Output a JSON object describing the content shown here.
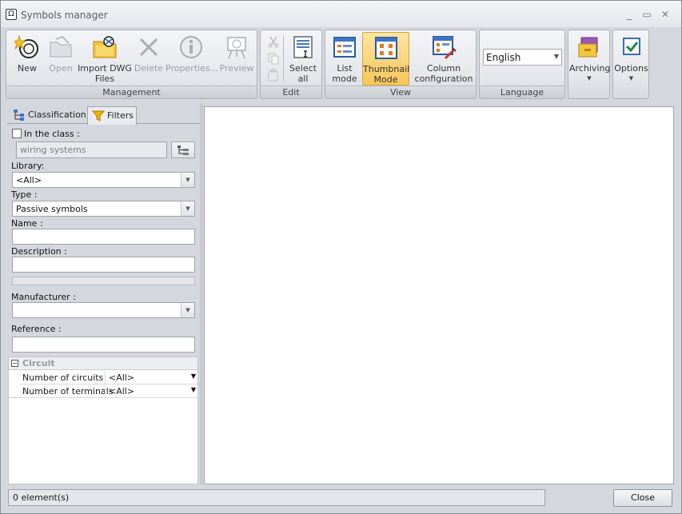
{
  "window": {
    "title": "Symbols manager",
    "minimize": "_",
    "maximize": "▭",
    "close": "✕"
  },
  "ribbon": {
    "management": {
      "label": "Management",
      "new": "New",
      "open": "Open",
      "import_line1": "Import DWG",
      "import_line2": "Files",
      "delete": "Delete",
      "properties": "Properties...",
      "preview": "Preview"
    },
    "edit": {
      "label": "Edit",
      "select_line1": "Select",
      "select_line2": "all"
    },
    "view": {
      "label": "View",
      "list_line1": "List",
      "list_line2": "mode",
      "thumb_line1": "Thumbnail",
      "thumb_line2": "Mode",
      "col_line1": "Column",
      "col_line2": "configuration"
    },
    "language": {
      "label": "Language",
      "value": "English"
    },
    "archiving": {
      "label": "Archiving"
    },
    "options": {
      "label": "Options"
    }
  },
  "tabs": {
    "classification": "Classification",
    "filters": "Filters"
  },
  "filters": {
    "in_class_label": "In the class :",
    "in_class_value": "wiring systems",
    "library_label": "Library:",
    "library_value": "<All>",
    "type_label": "Type :",
    "type_value": "Passive symbols",
    "name_label": "Name :",
    "name_value": "",
    "description_label": "Description :",
    "description_value": "",
    "manufacturer_label": "Manufacturer :",
    "manufacturer_value": "",
    "reference_label": "Reference :",
    "reference_value": ""
  },
  "circuit": {
    "category": "Circuit",
    "rows": [
      {
        "key": "Number of circuits",
        "value": "<All>"
      },
      {
        "key": "Number of terminals",
        "value": "<All>"
      }
    ]
  },
  "status": {
    "text": "0 element(s)"
  },
  "buttons": {
    "close": "Close"
  },
  "colors": {
    "accent_active": "#f8c65a",
    "ribbon_bg": "#e4e7eb",
    "frame": "#d4d8de"
  }
}
